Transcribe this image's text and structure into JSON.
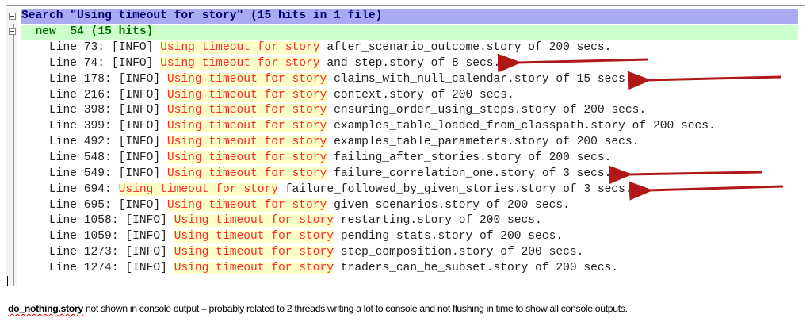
{
  "search": {
    "header": "Search \"Using timeout for story\" (15 hits in 1 file)",
    "file_label": "  new  54 (15 hits)",
    "match": "Using timeout for story",
    "results": [
      {
        "prefix": "Line 73: [INFO] ",
        "suffix": " after_scenario_outcome.story of 200 secs."
      },
      {
        "prefix": "Line 74: [INFO] ",
        "suffix": " and_step.story of 8 secs."
      },
      {
        "prefix": "Line 178: [INFO] ",
        "suffix": " claims_with_null_calendar.story of 15 secs."
      },
      {
        "prefix": "Line 216: [INFO] ",
        "suffix": " context.story of 200 secs."
      },
      {
        "prefix": "Line 398: [INFO] ",
        "suffix": " ensuring_order_using_steps.story of 200 secs."
      },
      {
        "prefix": "Line 399: [INFO] ",
        "suffix": " examples_table_loaded_from_classpath.story of 200 secs."
      },
      {
        "prefix": "Line 492: [INFO] ",
        "suffix": " examples_table_parameters.story of 200 secs."
      },
      {
        "prefix": "Line 548: [INFO] ",
        "suffix": " failing_after_stories.story of 200 secs."
      },
      {
        "prefix": "Line 549: [INFO] ",
        "suffix": " failure_correlation_one.story of 3 secs."
      },
      {
        "prefix": "Line 694: ",
        "suffix": " failure_followed_by_given_stories.story of 3 secs."
      },
      {
        "prefix": "Line 695: [INFO] ",
        "suffix": " given_scenarios.story of 200 secs."
      },
      {
        "prefix": "Line 1058: [INFO] ",
        "suffix": " restarting.story of 200 secs."
      },
      {
        "prefix": "Line 1059: [INFO] ",
        "suffix": " pending_stats.story of 200 secs."
      },
      {
        "prefix": "Line 1273: [INFO] ",
        "suffix": " step_composition.story of 200 secs."
      },
      {
        "prefix": "Line 1274: [INFO] ",
        "suffix": " traders_can_be_subset.story of 200 secs."
      }
    ]
  },
  "note": {
    "bold": "do_nothing.story",
    "text": " not shown in console output – probably related to 2 threads writing a lot to console and not flushing in time to show all console outputs."
  },
  "colors": {
    "header_bg": "#aaaaf2",
    "file_bg": "#ccffcc",
    "hit_bg": "#ffffc8",
    "hit_fg": "#ff2a2a",
    "arrow": "#b01818"
  }
}
